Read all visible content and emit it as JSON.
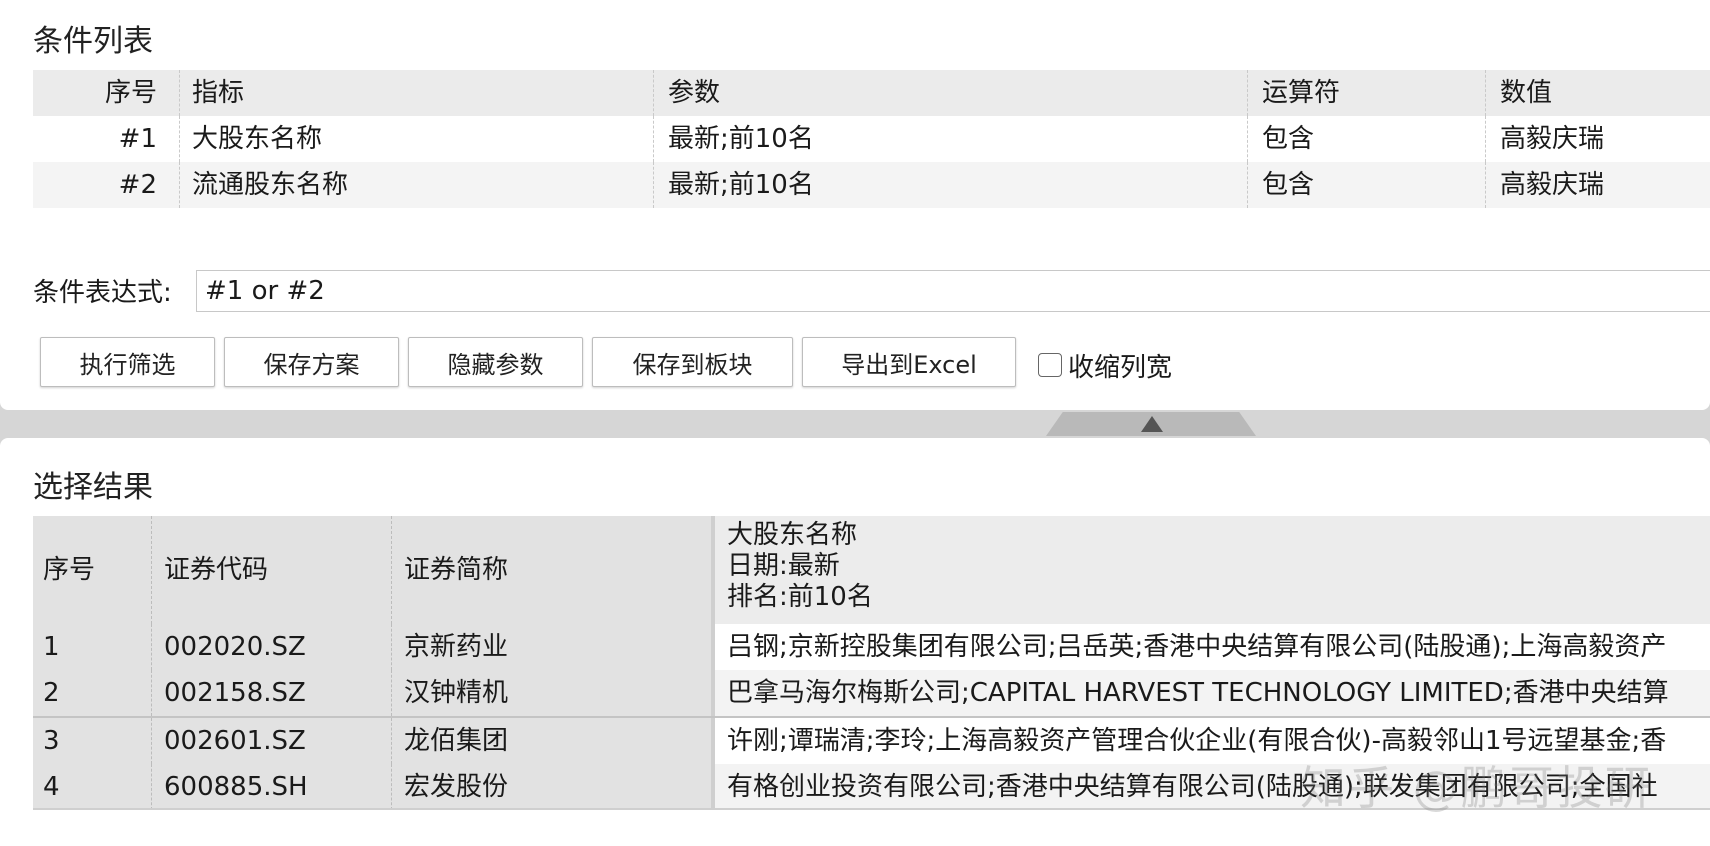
{
  "conditions": {
    "title": "条件列表",
    "headers": {
      "index": "序号",
      "indicator": "指标",
      "params": "参数",
      "operator": "运算符",
      "value": "数值"
    },
    "rows": [
      {
        "index": "#1",
        "indicator": "大股东名称",
        "params": "最新;前10名",
        "operator": "包含",
        "value": "高毅庆瑞"
      },
      {
        "index": "#2",
        "indicator": "流通股东名称",
        "params": "最新;前10名",
        "operator": "包含",
        "value": "高毅庆瑞"
      }
    ]
  },
  "expression": {
    "label": "条件表达式:",
    "value": "#1 or #2"
  },
  "toolbar": {
    "run": "执行筛选",
    "save_plan": "保存方案",
    "hide_params": "隐藏参数",
    "save_to_block": "保存到板块",
    "export_excel": "导出到Excel",
    "collapse_label": "收缩列宽",
    "collapse_checked": false
  },
  "results": {
    "title": "选择结果",
    "headers": {
      "index": "序号",
      "code": "证券代码",
      "name": "证券简称",
      "holder_line1": "大股东名称",
      "holder_line2": "日期:最新",
      "holder_line3": "排名:前10名"
    },
    "rows": [
      {
        "index": "1",
        "code": "002020.SZ",
        "name": "京新药业",
        "holders": "吕钢;京新控股集团有限公司;吕岳英;香港中央结算有限公司(陆股通);上海高毅资产"
      },
      {
        "index": "2",
        "code": "002158.SZ",
        "name": "汉钟精机",
        "holders": "巴拿马海尔梅斯公司;CAPITAL HARVEST TECHNOLOGY LIMITED;香港中央结算"
      },
      {
        "index": "3",
        "code": "002601.SZ",
        "name": "龙佰集团",
        "holders": "许刚;谭瑞清;李玲;上海高毅资产管理合伙企业(有限合伙)-高毅邻山1号远望基金;香"
      },
      {
        "index": "4",
        "code": "600885.SH",
        "name": "宏发股份",
        "holders": "有格创业投资有限公司;香港中央结算有限公司(陆股通);联发集团有限公司;全国社"
      }
    ]
  },
  "watermark": "知乎 @鹏哥投研"
}
